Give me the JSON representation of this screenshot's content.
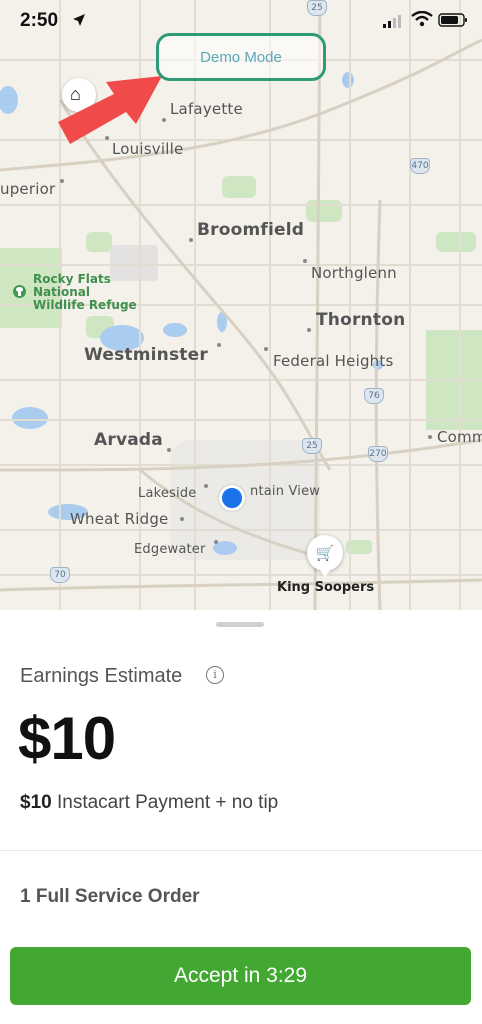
{
  "status_bar": {
    "time": "2:50",
    "icons": [
      "location-arrow-icon",
      "cellular-signal-icon",
      "wifi-icon",
      "battery-icon"
    ]
  },
  "map": {
    "demo_badge": "Demo Mode",
    "places": {
      "lafayette": "Lafayette",
      "louisville": "Louisville",
      "superior": "uperior",
      "broomfield": "Broomfield",
      "northglenn": "Northglenn",
      "thornton": "Thornton",
      "westminster": "Westminster",
      "federal_heights": "Federal Heights",
      "arvada": "Arvada",
      "lakeside": "Lakeside",
      "mountain_view": "ntain View",
      "wheat_ridge": "Wheat Ridge",
      "edgewater": "Edgewater",
      "commerce": "Comm"
    },
    "park_lines": [
      "Rocky Flats",
      "National",
      "Wildlife Refuge"
    ],
    "highway_shields": [
      "25",
      "470",
      "76",
      "25",
      "270",
      "70"
    ],
    "store_label": "King Soopers"
  },
  "sheet": {
    "earnings_title": "Earnings Estimate",
    "amount": "$10",
    "payment_amount": "$10",
    "payment_text": " Instacart Payment + no tip",
    "order_summary": "1 Full Service Order",
    "accept_label": "Accept in 3:29"
  },
  "colors": {
    "accent_green": "#43a831",
    "badge_border": "#2f9a78",
    "user_location": "#1a73e8",
    "annotation_arrow": "#f04a4a"
  }
}
